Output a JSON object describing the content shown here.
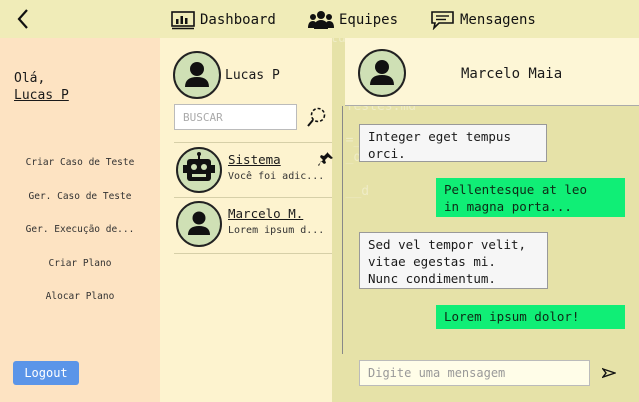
{
  "nav": {
    "items": [
      {
        "label": "Dashboard",
        "icon": "dashboard-icon"
      },
      {
        "label": "Equipes",
        "icon": "team-icon"
      },
      {
        "label": "Mensagens",
        "icon": "chat-icon"
      }
    ]
  },
  "sidebar": {
    "greeting": "Olá,",
    "user_name": "Lucas P",
    "menu": [
      "Criar Caso de Teste",
      "Ger. Caso de Teste",
      "Ger. Execução de...",
      "Criar Plano",
      "Alocar Plano"
    ],
    "logout_label": "Logout"
  },
  "contacts": {
    "me_name": "Lucas P",
    "search_placeholder": "BUSCAR",
    "list": [
      {
        "name": "Sistema",
        "preview": "Você foi adic...",
        "pinned": true,
        "avatar": "robot-icon"
      },
      {
        "name": "Marcelo M.",
        "preview": "Lorem ipsum d...",
        "pinned": false,
        "avatar": "user-icon"
      }
    ]
  },
  "chat": {
    "title": "Marcelo Maia",
    "messages": [
      {
        "dir": "in",
        "text": "Integer eget tempus\norci."
      },
      {
        "dir": "out",
        "text": "Pellentesque at leo\nin magna porta..."
      },
      {
        "dir": "in",
        "text": "Sed vel tempor velit,\nvitae egestas mi.\nNunc condimentum."
      },
      {
        "dir": "out",
        "text": "Lorem ipsum dolor!"
      }
    ],
    "compose_placeholder": "Digite uma mensagem"
  },
  "colors": {
    "sidebar_bg": "#fde3c2",
    "outgoing_bubble": "#10ee76",
    "logout_button": "#5b95e8"
  }
}
